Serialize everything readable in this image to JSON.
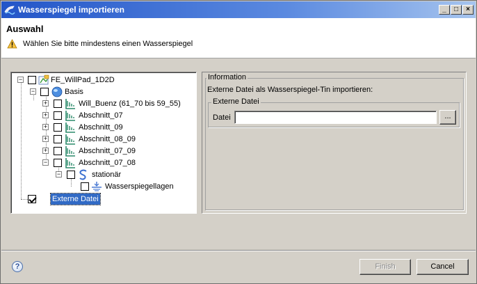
{
  "window": {
    "title": "Wasserspiegel importieren",
    "controls": {
      "minimize": "_",
      "maximize": "□",
      "close": "×"
    }
  },
  "header": {
    "title": "Auswahl",
    "message": "Wählen Sie bitte mindestens einen Wasserspiegel",
    "icon": "warning-icon"
  },
  "tree": {
    "items": [
      {
        "label": "FE_WillPad_1D2D",
        "icon": "model-icon",
        "expander": "−",
        "checked": false
      },
      {
        "label": "Basis",
        "icon": "globe-icon",
        "expander": "−",
        "checked": false
      },
      {
        "label": "Will_Buenz (61_70 bis 59_55)",
        "icon": "river-icon",
        "expander": "+",
        "checked": false
      },
      {
        "label": "Abschnitt_07",
        "icon": "river-icon",
        "expander": "+",
        "checked": false
      },
      {
        "label": "Abschnitt_09",
        "icon": "river-icon",
        "expander": "+",
        "checked": false
      },
      {
        "label": "Abschnitt_08_09",
        "icon": "river-icon",
        "expander": "+",
        "checked": false
      },
      {
        "label": "Abschnitt_07_09",
        "icon": "river-icon",
        "expander": "+",
        "checked": false
      },
      {
        "label": "Abschnitt_07_08",
        "icon": "river-icon",
        "expander": "−",
        "checked": false
      },
      {
        "label": "stationär",
        "icon": "calculation-icon",
        "expander": "−",
        "checked": false
      },
      {
        "label": "Wasserspiegellagen",
        "icon": "waterlevel-icon",
        "expander": "",
        "checked": false
      },
      {
        "label": "Externe Datei",
        "icon": "",
        "expander": "",
        "checked": true,
        "selected": true
      }
    ]
  },
  "info": {
    "group_title": "Information",
    "description": "Externe Datei als Wasserspiegel-Tin importieren:",
    "file_group_title": "Externe Datei",
    "file_label": "Datei",
    "file_value": "",
    "browse_label": "..."
  },
  "footer": {
    "help_label": "?",
    "finish_label": "Finish",
    "cancel_label": "Cancel"
  },
  "colors": {
    "title_gradient_start": "#2355c8",
    "selection": "#316ac5",
    "dialog_bg": "#d4d0c8"
  }
}
